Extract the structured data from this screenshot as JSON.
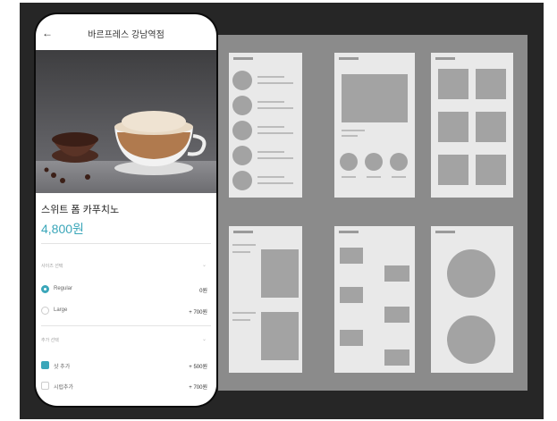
{
  "header": {
    "title": "바르프레스 강남역점",
    "back_icon": "arrow-left-icon"
  },
  "product": {
    "name": "스위트 폼 카푸치노",
    "price": "4,800원"
  },
  "sections": [
    {
      "title": "사이즈 선택",
      "options": [
        {
          "label": "Regular",
          "price": "0원",
          "control": "radio",
          "selected": true
        },
        {
          "label": "Large",
          "price": "+ 700원",
          "control": "radio",
          "selected": false
        }
      ]
    },
    {
      "title": "추가 선택",
      "options": [
        {
          "label": "샷 추가",
          "price": "+ 500원",
          "control": "checkbox",
          "selected": true
        },
        {
          "label": "시럽추가",
          "price": "+ 700원",
          "control": "checkbox",
          "selected": false
        }
      ]
    }
  ],
  "colors": {
    "accent": "#3aa6b9",
    "background": "#262626",
    "wireframe_panel": "#8b8b8b"
  }
}
